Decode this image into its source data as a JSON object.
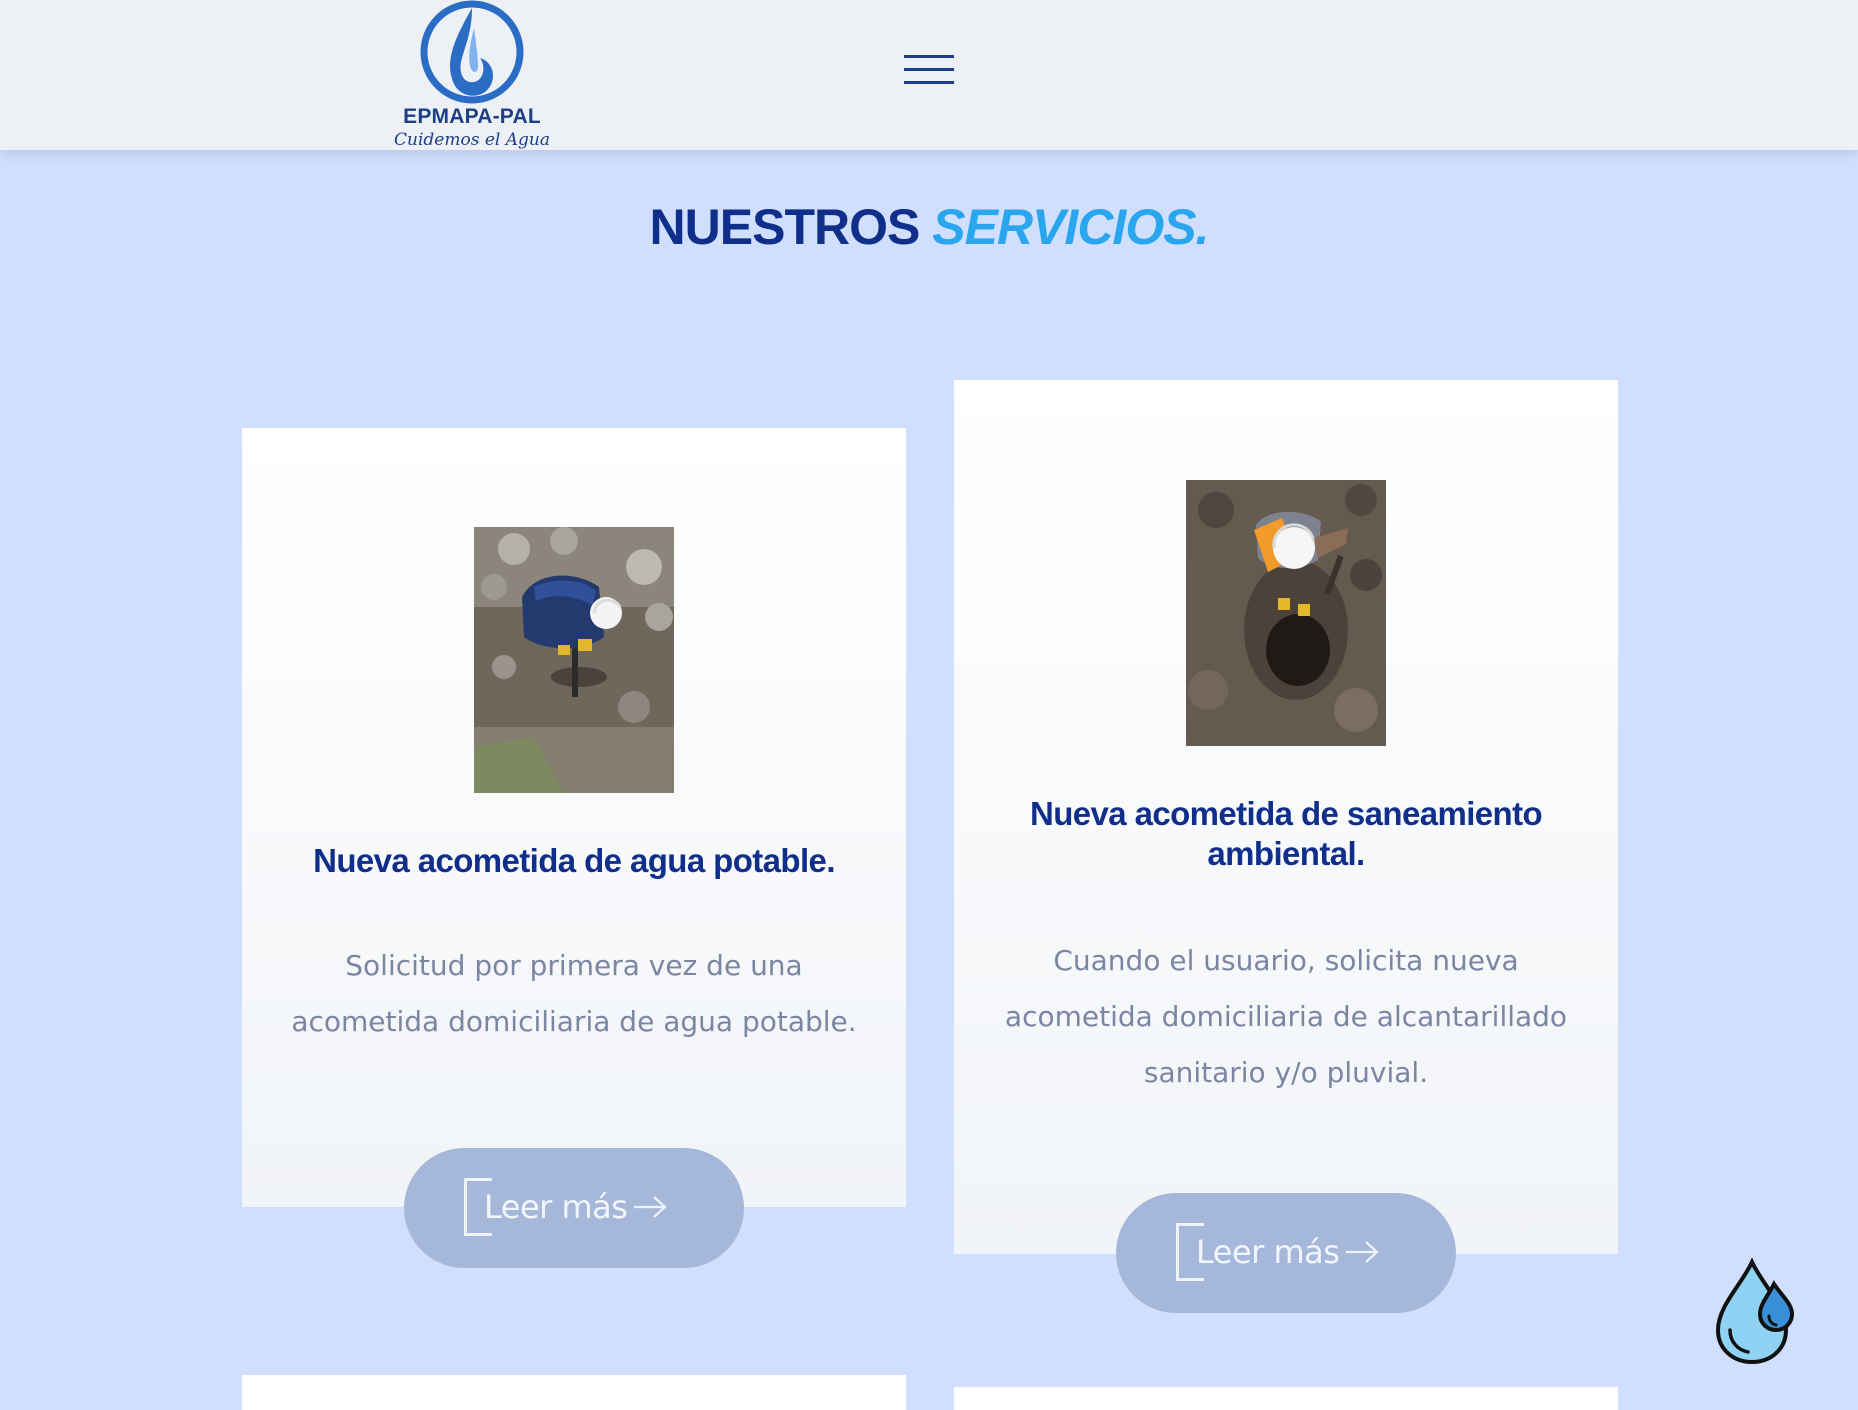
{
  "header": {
    "logo": {
      "name": "EPMAPA-PAL",
      "tagline": "Cuidemos el Agua",
      "colors": {
        "blue": "#1d3f86",
        "accent": "#3a7bd5"
      }
    },
    "menu_icon": "hamburger-menu-icon"
  },
  "section": {
    "title_main": "NUESTROS",
    "title_accent": "SERVICIOS."
  },
  "services": [
    {
      "image_alt": "worker-digging-water-pipe",
      "title": "Nueva acometida de agua potable.",
      "description": "Solicitud por primera vez de una acometida domiciliaria de agua potable.",
      "button_label": "Leer más",
      "button_icon": "arrow-right-icon"
    },
    {
      "image_alt": "worker-digging-sewer-hole",
      "title": "Nueva acometida de saneamiento ambiental.",
      "description": "Cuando el usuario, solicita nueva acometida domiciliaria de alcantarillado sanitario y/o pluvial.",
      "button_label": "Leer más",
      "button_icon": "arrow-right-icon"
    }
  ],
  "floating_widget": {
    "icon": "water-drop-icon"
  },
  "colors": {
    "page_background": "#cfdffd",
    "header_background": "#edf1f6",
    "title_dark": "#102f8a",
    "title_accent": "#2aa6ee",
    "body_text": "#7b86a3",
    "button_background": "#a6b8da"
  }
}
